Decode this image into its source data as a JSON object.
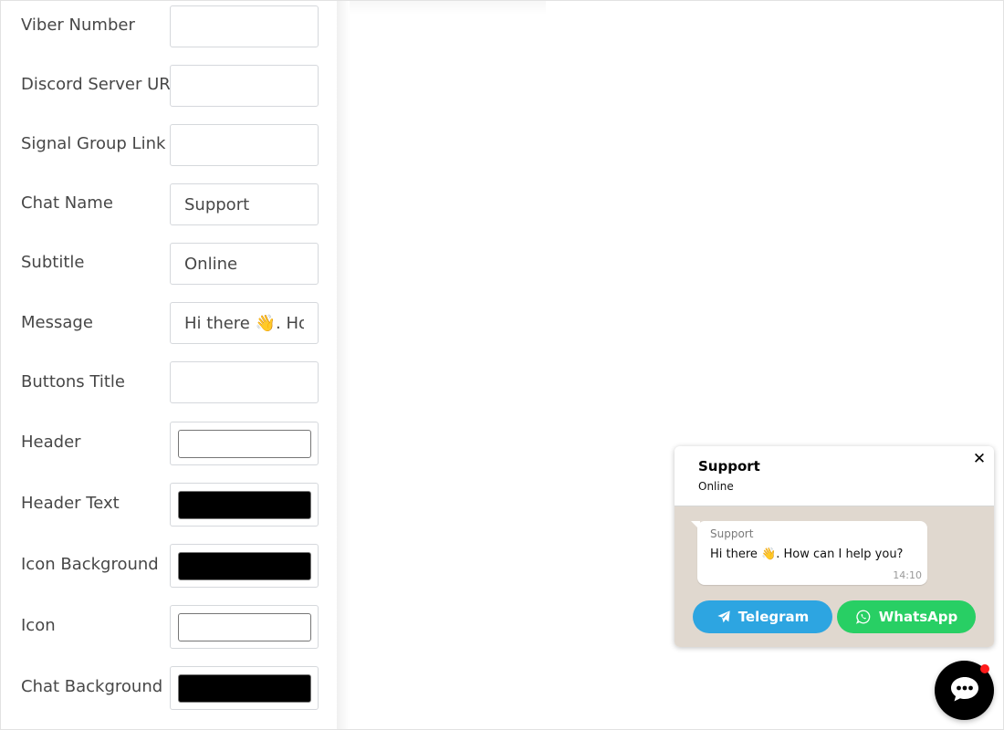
{
  "settings": {
    "fields": [
      {
        "label": "Viber Number",
        "value": "",
        "type": "text"
      },
      {
        "label": "Discord Server URL",
        "value": "",
        "type": "text"
      },
      {
        "label": "Signal Group Link",
        "value": "",
        "type": "text"
      },
      {
        "label": "Chat Name",
        "value": "Support",
        "type": "text"
      },
      {
        "label": "Subtitle",
        "value": "Online",
        "type": "text"
      },
      {
        "label": "Message",
        "value": "Hi there 👋. How can I help you?",
        "type": "text"
      },
      {
        "label": "Buttons Title",
        "value": "",
        "type": "text"
      },
      {
        "label": "Header",
        "value": "#ffffff",
        "type": "color"
      },
      {
        "label": "Header Text",
        "value": "#000000",
        "type": "color"
      },
      {
        "label": "Icon Background",
        "value": "#000000",
        "type": "color"
      },
      {
        "label": "Icon",
        "value": "#ffffff",
        "type": "color"
      },
      {
        "label": "Chat Background",
        "value": "#000000",
        "type": "color"
      }
    ]
  },
  "widget": {
    "title": "Support",
    "subtitle": "Online",
    "close_label": "✕",
    "bubble": {
      "name": "Support",
      "text": "Hi there 👋. How can I help you?",
      "time": "14:10"
    },
    "buttons": [
      {
        "label": "Telegram",
        "icon": "telegram-icon",
        "color": "#2da5e1"
      },
      {
        "label": "WhatsApp",
        "icon": "whatsapp-icon",
        "color": "#28cf64"
      }
    ]
  },
  "launcher": {
    "icon": "chat-bubble-icon",
    "color": "#000000",
    "badge_color": "#ff1a1a"
  }
}
